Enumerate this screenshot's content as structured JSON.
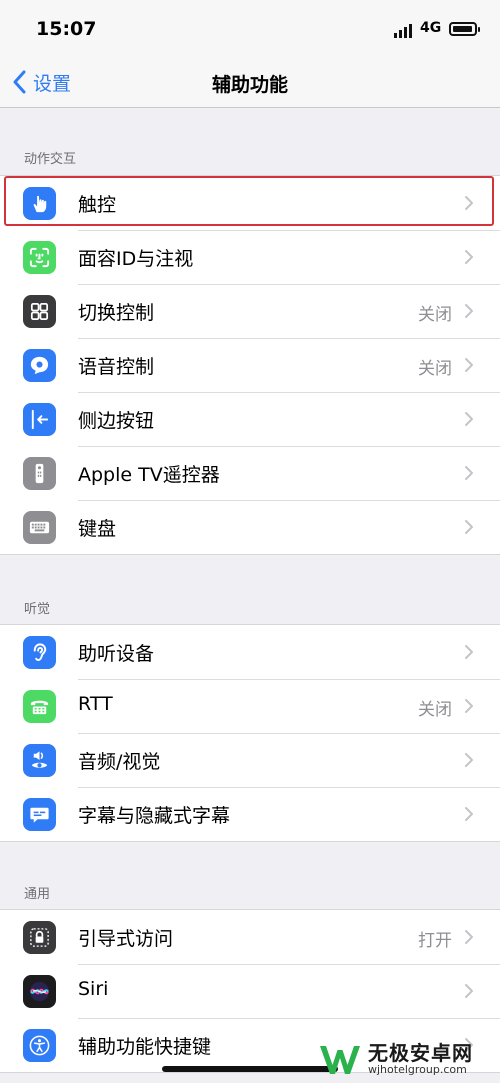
{
  "status_bar": {
    "time": "15:07",
    "network": "4G"
  },
  "nav": {
    "back_label": "设置",
    "title": "辅助功能"
  },
  "sections": {
    "physical": {
      "header": "动作交互",
      "items": [
        {
          "label": "触控",
          "value": ""
        },
        {
          "label": "面容ID与注视",
          "value": ""
        },
        {
          "label": "切换控制",
          "value": "关闭"
        },
        {
          "label": "语音控制",
          "value": "关闭"
        },
        {
          "label": "侧边按钮",
          "value": ""
        },
        {
          "label": "Apple TV遥控器",
          "value": ""
        },
        {
          "label": "键盘",
          "value": ""
        }
      ]
    },
    "hearing": {
      "header": "听觉",
      "items": [
        {
          "label": "助听设备",
          "value": ""
        },
        {
          "label": "RTT",
          "value": "关闭"
        },
        {
          "label": "音频/视觉",
          "value": ""
        },
        {
          "label": "字幕与隐藏式字幕",
          "value": ""
        }
      ]
    },
    "general": {
      "header": "通用",
      "items": [
        {
          "label": "引导式访问",
          "value": "打开"
        },
        {
          "label": "Siri",
          "value": ""
        },
        {
          "label": "辅助功能快捷键",
          "value": ""
        }
      ]
    }
  },
  "icons": {
    "touch": "hand-pointer-icon",
    "face_id": "face-id-icon",
    "switch_control": "grid-squares-icon",
    "voice_control": "voice-control-icon",
    "side_button": "side-button-icon",
    "apple_tv_remote": "remote-icon",
    "keyboard": "keyboard-icon",
    "hearing_devices": "ear-icon",
    "rtt": "tty-phone-icon",
    "audio_visual": "speaker-eye-icon",
    "subtitles": "caption-bubble-icon",
    "guided_access": "lock-icon",
    "siri": "siri-icon",
    "shortcut": "accessibility-person-icon",
    "chevron": "chevron-right-icon",
    "back": "chevron-left-icon"
  },
  "colors": {
    "accent_blue": "#2f7cf6",
    "green": "#4cd964",
    "dark_gray": "#3a3a3c",
    "light_gray": "#8e8e93",
    "highlight_red": "#d1343a",
    "background": "#efeff4"
  },
  "watermark": {
    "name": "无极安卓网",
    "url": "wjhotelgroup.com"
  }
}
